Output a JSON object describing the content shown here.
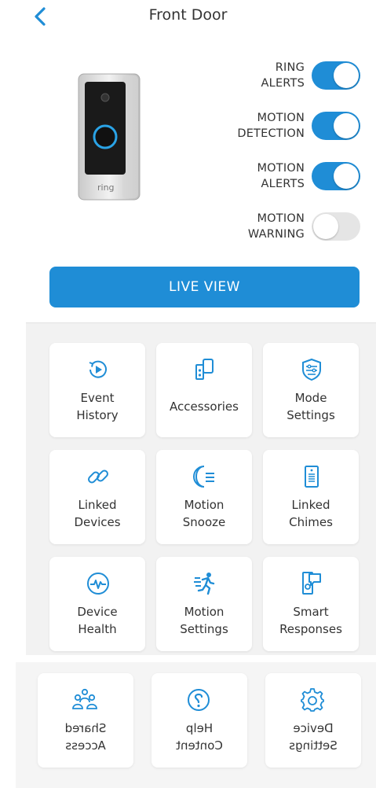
{
  "header": {
    "title": "Front Door"
  },
  "device": {
    "brand_text": "ring"
  },
  "toggles": [
    {
      "line1": "RING",
      "line2": "ALERTS",
      "state": "on"
    },
    {
      "line1": "MOTION",
      "line2": "DETECTION",
      "state": "on"
    },
    {
      "line1": "MOTION",
      "line2": "ALERTS",
      "state": "on"
    },
    {
      "line1": "MOTION",
      "line2": "WARNING",
      "state": "off"
    }
  ],
  "live_view": {
    "label": "LIVE VIEW"
  },
  "tiles": [
    {
      "line1": "Event",
      "line2": "History",
      "icon": "event-history-icon"
    },
    {
      "line1": "Accessories",
      "line2": "",
      "icon": "accessories-icon"
    },
    {
      "line1": "Mode",
      "line2": "Settings",
      "icon": "mode-settings-icon"
    },
    {
      "line1": "Linked",
      "line2": "Devices",
      "icon": "link-icon"
    },
    {
      "line1": "Motion",
      "line2": "Snooze",
      "icon": "moon-snooze-icon"
    },
    {
      "line1": "Linked",
      "line2": "Chimes",
      "icon": "chime-icon"
    },
    {
      "line1": "Device",
      "line2": "Health",
      "icon": "heartbeat-icon"
    },
    {
      "line1": "Motion",
      "line2": "Settings",
      "icon": "running-person-icon"
    },
    {
      "line1": "Smart",
      "line2": "Responses",
      "icon": "smart-responses-icon"
    },
    {
      "line1": "Shared",
      "line2": "Access",
      "icon": "shared-users-icon"
    },
    {
      "line1": "Help",
      "line2": "Content",
      "icon": "help-icon"
    },
    {
      "line1": "Device",
      "line2": "Settings",
      "icon": "gear-icon"
    }
  ],
  "colors": {
    "accent": "#1f8dd6",
    "toggle_off": "#e5e5e5",
    "grid_bg": "#f2f2f2"
  }
}
